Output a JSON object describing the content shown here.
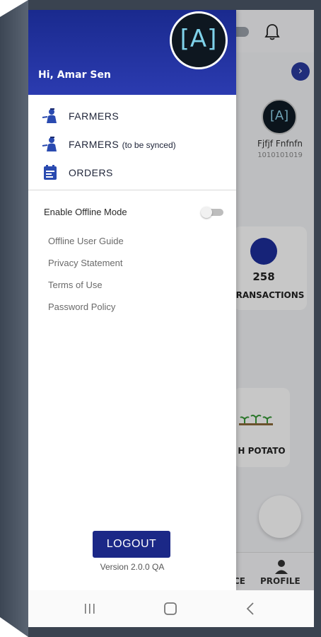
{
  "drawer": {
    "greeting": "Hi, Amar Sen",
    "logo_text": "[A]",
    "menu": [
      {
        "label": "FARMERS",
        "sub": "",
        "icon": "farmer-icon"
      },
      {
        "label": "FARMERS",
        "sub": "(to be synced)",
        "icon": "farmer-sync-icon"
      },
      {
        "label": "ORDERS",
        "sub": "",
        "icon": "orders-icon"
      }
    ],
    "offline_mode": {
      "label": "Enable Offline Mode",
      "enabled": false
    },
    "links": [
      "Offline User Guide",
      "Privacy Statement",
      "Terms of Use",
      "Password Policy"
    ],
    "logout_label": "LOGOUT",
    "version": "Version 2.0.0  QA"
  },
  "background": {
    "avatar_text": "[A]",
    "farmer_name": "Fjfjf Fnfnfn",
    "farmer_id": "1010101019",
    "transactions_count": "258",
    "transactions_label": "RANSACTIONS",
    "crop_label": "H POTATO",
    "nav_partial": "CE",
    "nav_profile": "PROFILE"
  },
  "colors": {
    "primary": "#1b2887",
    "header_gradient_top": "#1a2a8e",
    "header_gradient_bottom": "#2b3bb0",
    "logo_text": "#7fd2ea"
  },
  "android_nav": {
    "icons": [
      "recents-icon",
      "home-icon",
      "back-icon"
    ]
  }
}
